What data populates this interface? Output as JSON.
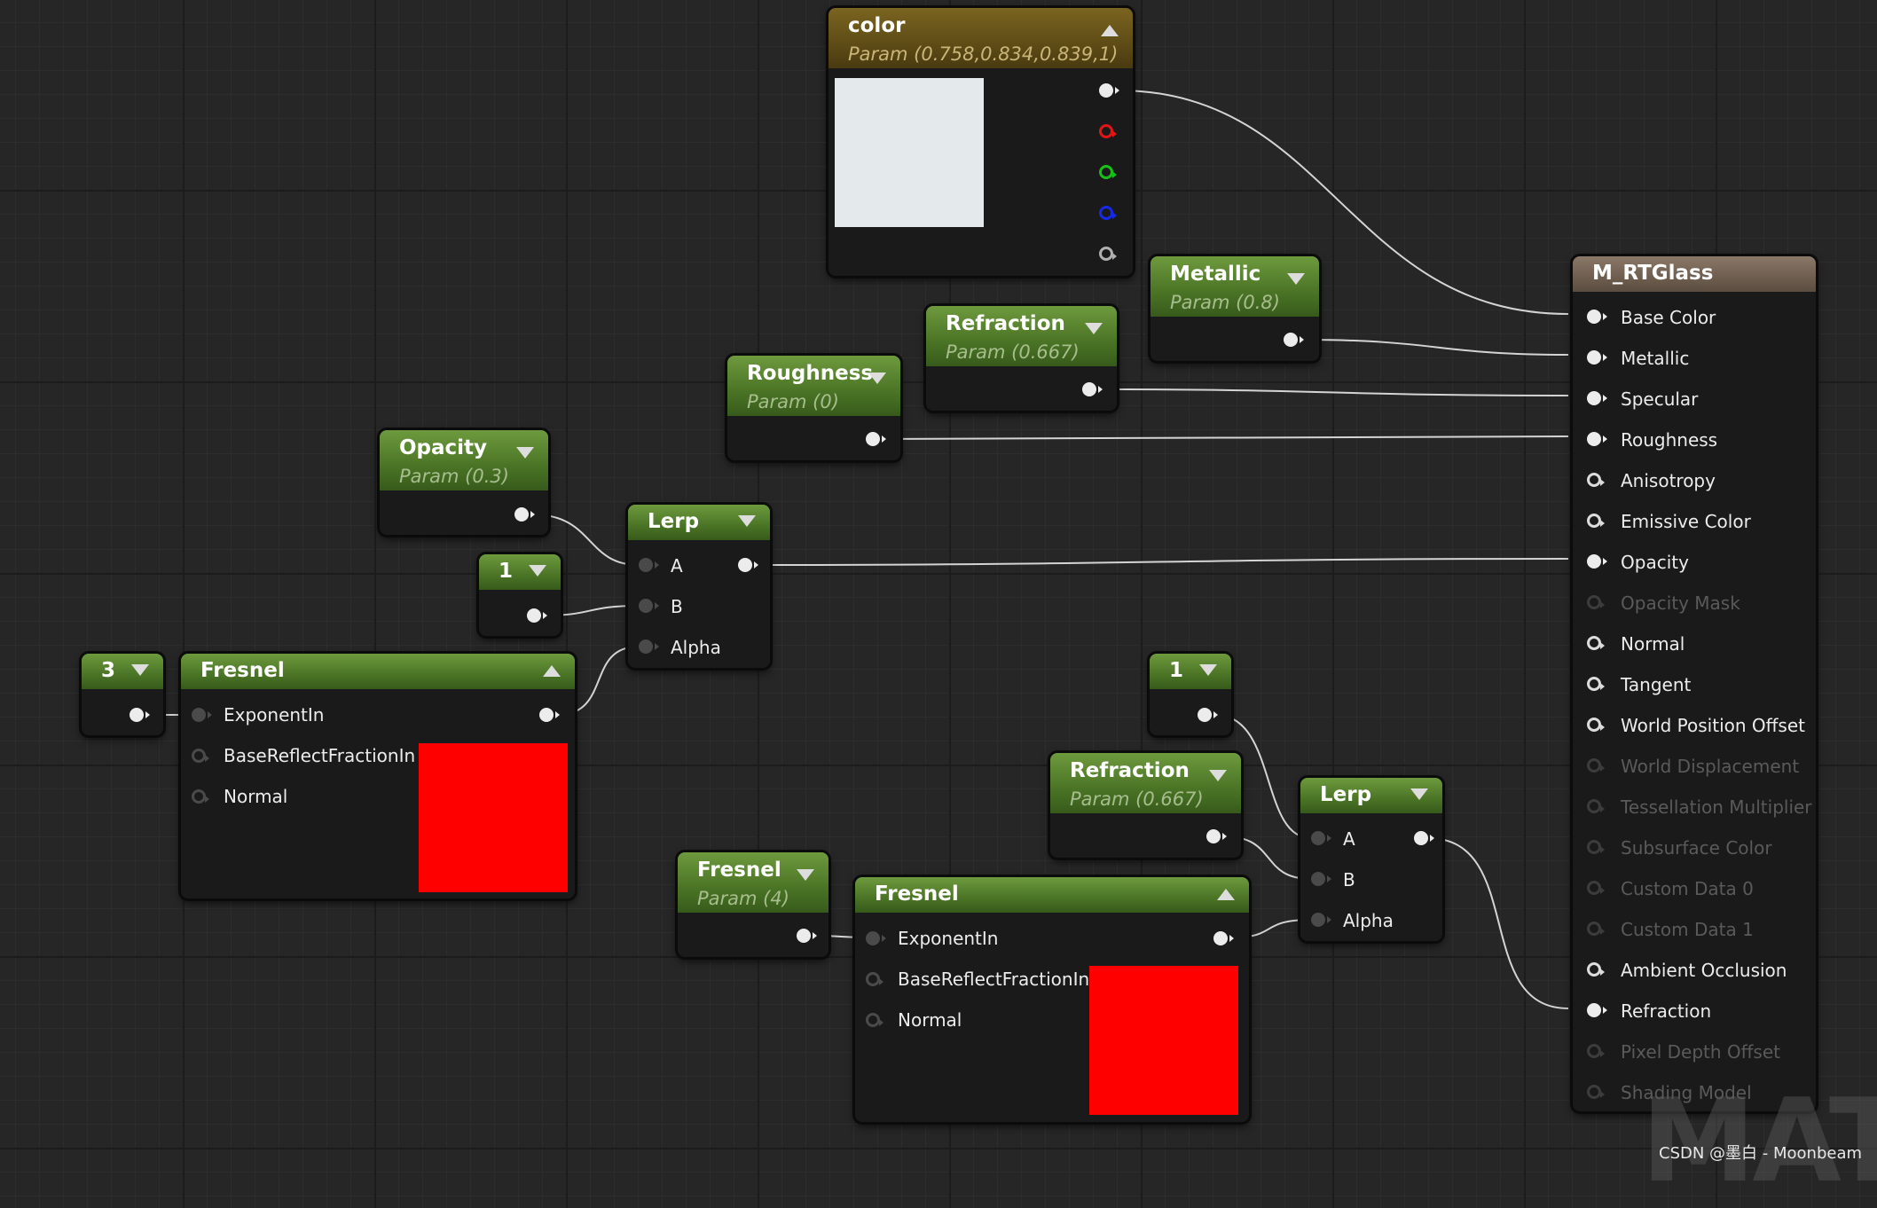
{
  "material": {
    "title": "M_RTGlass",
    "inputs": [
      "Base Color",
      "Metallic",
      "Specular",
      "Roughness",
      "Anisotropy",
      "Emissive Color",
      "Opacity",
      "Opacity Mask",
      "Normal",
      "Tangent",
      "World Position Offset",
      "World Displacement",
      "Tessellation Multiplier",
      "Subsurface Color",
      "Custom Data 0",
      "Custom Data 1",
      "Ambient Occlusion",
      "Refraction",
      "Pixel Depth Offset",
      "Shading Model"
    ]
  },
  "nodes": {
    "color": {
      "title": "color",
      "subtitle": "Param (0.758,0.834,0.839,1)",
      "swatch": "#e4eaeb"
    },
    "metallic": {
      "title": "Metallic",
      "subtitle": "Param (0.8)"
    },
    "refraction1": {
      "title": "Refraction",
      "subtitle": "Param (0.667)"
    },
    "roughness": {
      "title": "Roughness",
      "subtitle": "Param (0)"
    },
    "opacity": {
      "title": "Opacity",
      "subtitle": "Param (0.3)"
    },
    "const1a": {
      "value": "1"
    },
    "const3": {
      "value": "3"
    },
    "const1b": {
      "value": "1"
    },
    "refraction2": {
      "title": "Refraction",
      "subtitle": "Param (0.667)"
    },
    "fresnelParam": {
      "title": "Fresnel",
      "subtitle": "Param (4)"
    },
    "lerp1": {
      "title": "Lerp",
      "a": "A",
      "b": "B",
      "alpha": "Alpha"
    },
    "lerp2": {
      "title": "Lerp",
      "a": "A",
      "b": "B",
      "alpha": "Alpha"
    },
    "fresnel1": {
      "title": "Fresnel",
      "exponent": "ExponentIn",
      "base": "BaseReflectFractionIn",
      "normal": "Normal",
      "swatch": "#ff0000"
    },
    "fresnel2": {
      "title": "Fresnel",
      "exponent": "ExponentIn",
      "base": "BaseReflectFractionIn",
      "normal": "Normal",
      "swatch": "#ff0000"
    }
  },
  "watermark": "MATE",
  "credit": "CSDN @墨白 - Moonbeam"
}
